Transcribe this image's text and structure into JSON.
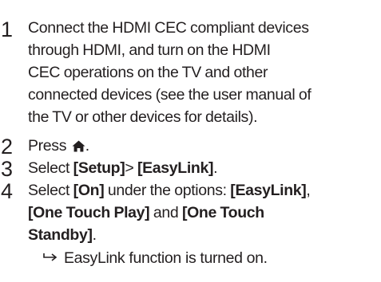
{
  "steps": [
    {
      "number": "1",
      "lines": [
        "Connect the HDMI CEC compliant devices",
        "through HDMI, and turn on the HDMI",
        "CEC operations on the TV and other",
        "connected devices (see the user manual of",
        "the TV or other devices for details)."
      ]
    },
    {
      "number": "2",
      "prefix": "Press",
      "suffix": ".",
      "icon": "home-icon"
    },
    {
      "number": "3",
      "prefix": "Select ",
      "bold1": "[Setup]",
      "middle": "> ",
      "bold2": "[EasyLink]",
      "suffix": "."
    },
    {
      "number": "4",
      "line1_prefix": "Select ",
      "line1_bold1": "[On]",
      "line1_middle": " under the options: ",
      "line1_bold2": "[EasyLink]",
      "line1_suffix": ",",
      "line2_bold": "[One Touch Play]",
      "line2_middle": " and ",
      "line2_bold2": "[One Touch",
      "line3_bold": "Standby]",
      "line3_suffix": ".",
      "result_icon": "arrow-right-icon",
      "result": "EasyLink function is turned on."
    }
  ]
}
